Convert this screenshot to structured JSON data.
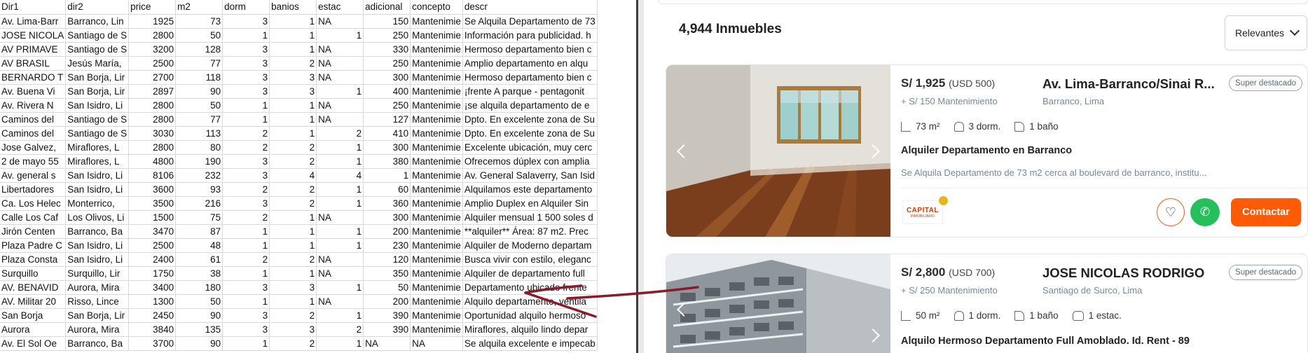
{
  "sheet": {
    "headers": [
      "Dir1",
      "dir2",
      "price",
      "m2",
      "dorm",
      "banios",
      "estac",
      "adicional",
      "concepto",
      "descr"
    ],
    "rows": [
      [
        "Av. Lima-Barr",
        "Barranco, Lin",
        "1925",
        "73",
        "3",
        "1",
        "NA",
        "150",
        "Mantenimie",
        "Se Alquila Departamento de 73"
      ],
      [
        "JOSE NICOLA",
        "Santiago de S",
        "2800",
        "50",
        "1",
        "1",
        "1",
        "250",
        "Mantenimie",
        "Información para publicidad. h"
      ],
      [
        "AV PRIMAVE",
        "Santiago de S",
        "3200",
        "128",
        "3",
        "1",
        "NA",
        "330",
        "Mantenimie",
        "Hermoso departamento bien c"
      ],
      [
        "AV BRASIL",
        "Jesús María,",
        "2500",
        "77",
        "3",
        "2",
        "NA",
        "250",
        "Mantenimie",
        "Amplio departamento en alqu"
      ],
      [
        "BERNARDO T",
        "San Borja, Lir",
        "2700",
        "118",
        "3",
        "3",
        "NA",
        "300",
        "Mantenimie",
        "Hermoso departamento bien c"
      ],
      [
        "Av. Buena Vi",
        "San Borja, Lir",
        "2897",
        "90",
        "3",
        "3",
        "1",
        "400",
        "Mantenimie",
        "¡frente A parque - pentagonit"
      ],
      [
        "Av. Rivera N",
        "San Isidro, Li",
        "2800",
        "50",
        "1",
        "1",
        "NA",
        "250",
        "Mantenimie",
        "¡se alquila departamento de e"
      ],
      [
        "Caminos del",
        "Santiago de S",
        "2800",
        "77",
        "1",
        "1",
        "NA",
        "127",
        "Mantenimie",
        "Dpto. En excelente zona de Su"
      ],
      [
        "Caminos del",
        "Santiago de S",
        "3030",
        "113",
        "2",
        "1",
        "2",
        "410",
        "Mantenimie",
        "Dpto. En excelente zona de Su"
      ],
      [
        "Jose Galvez,",
        "Miraflores, L",
        "2800",
        "80",
        "2",
        "2",
        "1",
        "300",
        "Mantenimie",
        "Excelente ubicación, muy cerc"
      ],
      [
        "2 de mayo 55",
        "Miraflores, L",
        "4800",
        "190",
        "3",
        "2",
        "1",
        "380",
        "Mantenimie",
        "Ofrecemos dúplex con amplia"
      ],
      [
        "Av. general s",
        "San Isidro, Li",
        "8106",
        "232",
        "3",
        "4",
        "4",
        "1",
        "Mantenimie",
        "Av. General Salaverry, San Isid"
      ],
      [
        "Libertadores",
        "San Isidro, Li",
        "3600",
        "93",
        "2",
        "2",
        "1",
        "60",
        "Mantenimie",
        "Alquilamos este departamento"
      ],
      [
        "Ca. Los Helec",
        "Monterrico,",
        "3500",
        "216",
        "3",
        "2",
        "1",
        "360",
        "Mantenimie",
        "Amplio Duplex en Alquiler Sin"
      ],
      [
        "Calle Los Caf",
        "Los Olivos, Li",
        "1500",
        "75",
        "2",
        "1",
        "NA",
        "300",
        "Mantenimie",
        "Alquiler mensual  1 500 soles d"
      ],
      [
        "Jirón Centen",
        "Barranco, Ba",
        "3470",
        "87",
        "1",
        "1",
        "1",
        "200",
        "Mantenimie",
        "**alquiler** Área: 87 m2. Prec"
      ],
      [
        "Plaza Padre C",
        "San Isidro, Li",
        "2500",
        "48",
        "1",
        "1",
        "1",
        "230",
        "Mantenimie",
        "Alquiler de Moderno departam"
      ],
      [
        "Plaza Consta",
        "San Isidro, Li",
        "2400",
        "61",
        "2",
        "2",
        "NA",
        "120",
        "Mantenimie",
        "Busca vivir con estilo, eleganc"
      ],
      [
        "Surquillo",
        "Surquillo, Lir",
        "1750",
        "38",
        "1",
        "1",
        "NA",
        "350",
        "Mantenimie",
        "Alquiler de departamento full"
      ],
      [
        "AV. BENAVID",
        "Aurora, Mira",
        "3400",
        "180",
        "3",
        "3",
        "1",
        "50",
        "Mantenimie",
        "Departamento ubicado frente"
      ],
      [
        "AV. Militar 20",
        "Risso, Lince",
        "1300",
        "50",
        "1",
        "1",
        "NA",
        "200",
        "Mantenimie",
        "Alquilo departamento, ventila"
      ],
      [
        "San Borja",
        "San Borja, Lir",
        "2450",
        "90",
        "3",
        "2",
        "1",
        "390",
        "Mantenimie",
        "Oportunidad alquilo hermoso"
      ],
      [
        "Aurora",
        "Aurora, Mira",
        "3840",
        "135",
        "3",
        "3",
        "2",
        "390",
        "Mantenimie",
        "Miraflores, alquilo lindo depar"
      ],
      [
        "Av. El Sol Oe",
        "Barranco, Ba",
        "3700",
        "90",
        "1",
        "2",
        "1",
        "NA",
        "NA",
        "Se alquila excelente e impecab"
      ]
    ]
  },
  "site": {
    "count_label": "4,944 Inmuebles",
    "sort_label": "Relevantes",
    "listings": [
      {
        "price": "S/ 1,925",
        "usd": "(USD 500)",
        "maintenance": "+ S/ 150 Mantenimiento",
        "address": "Av. Lima-Barranco/Sinai R...",
        "location": "Barranco, Lima",
        "badge": "Super destacado",
        "area": "73 m²",
        "bedrooms": "3 dorm.",
        "bathrooms": "1 baño",
        "title": "Alquiler Departamento en Barranco",
        "description": "Se Alquila Departamento de 73 m2 cerca al boulevard de barranco, institu...",
        "agency_logo_text": "CAPITAL",
        "agency_logo_sub": "INMOBILIARIO",
        "contact_label": "Contactar"
      },
      {
        "price": "S/ 2,800",
        "usd": "(USD 700)",
        "maintenance": "+ S/ 250 Mantenimiento",
        "address": "JOSE NICOLAS RODRIGO",
        "location": "Santiago de Surco, Lima",
        "badge": "Super destacado",
        "area": "50 m²",
        "bedrooms": "1 dorm.",
        "bathrooms": "1 baño",
        "parking": "1 estac.",
        "title": "Alquilo Hermoso Departamento Full Amoblado. Id. Rent - 89"
      }
    ]
  },
  "colors": {
    "accent": "#ff5a06",
    "whatsapp": "#25c05c",
    "annotation_arrow": "#8b1a2b"
  },
  "icons": [
    "area-icon",
    "bed-icon",
    "bath-icon",
    "car-icon",
    "heart-icon",
    "whatsapp-icon",
    "chevron-left-icon",
    "chevron-right-icon",
    "chevron-down-icon",
    "crown-icon"
  ]
}
